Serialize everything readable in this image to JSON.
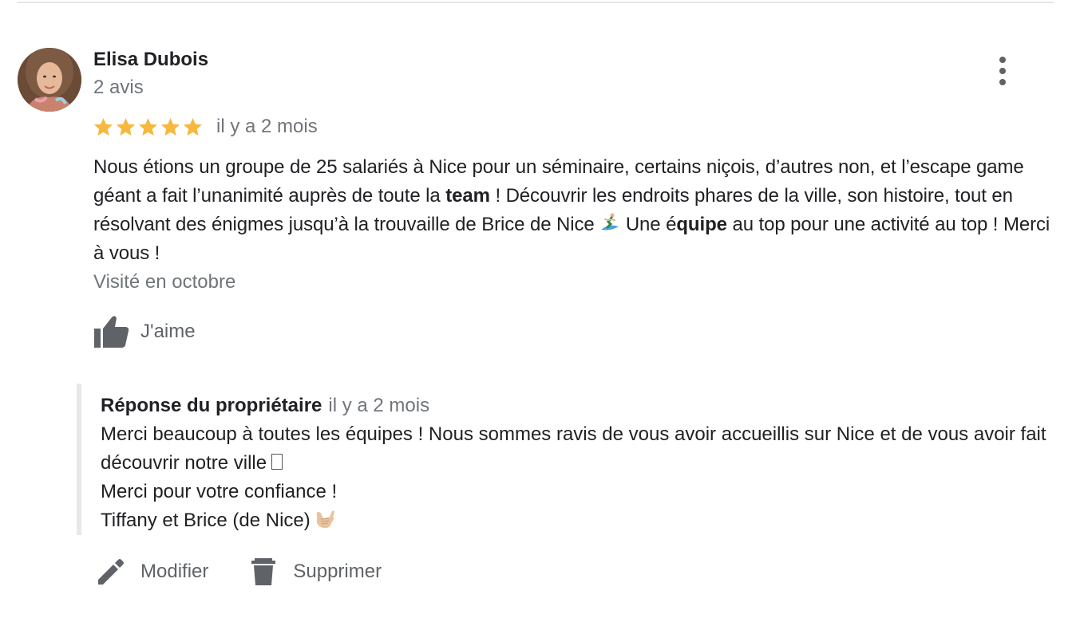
{
  "divider": true,
  "review": {
    "author": {
      "name": "Elisa Dubois",
      "reviews_count": "2 avis"
    },
    "rating": 5,
    "rating_color": "#f6b83f",
    "date": "il y a 2 mois",
    "text": {
      "part1": "Nous étions un groupe de 25 salariés à Nice pour un séminaire, certains niçois, d’autres non, et l’escape game géant a fait l’unanimité auprès de toute la ",
      "bold1": "team",
      "part2": " ! Découvrir les endroits phares de la ville, son histoire, tout en résolvant des énigmes jusqu’à la trouvaille de Brice de Nice ",
      "emoji": "surfer-icon",
      "part3": " Une é",
      "bold2": "quipe",
      "part4": " au top pour une activité au top ! Merci à vous !"
    },
    "visited": "Visité en octobre",
    "like_label": "J'aime"
  },
  "owner_reply": {
    "title": "Réponse du propriétaire",
    "date": "il y a 2 mois",
    "lines": [
      "Merci beaucoup à toutes les équipes ! Nous sommes ravis de vous avoir accueillis sur Nice et de vous avoir fait découvrir notre ville",
      "Merci pour votre confiance !",
      "Tiffany et Brice (de Nice)"
    ]
  },
  "actions": {
    "edit_label": "Modifier",
    "delete_label": "Supprimer"
  },
  "colors": {
    "text_primary": "#202124",
    "text_secondary": "#70757a",
    "icon_gray": "#5f6368",
    "reply_border": "#e8e8e8"
  }
}
